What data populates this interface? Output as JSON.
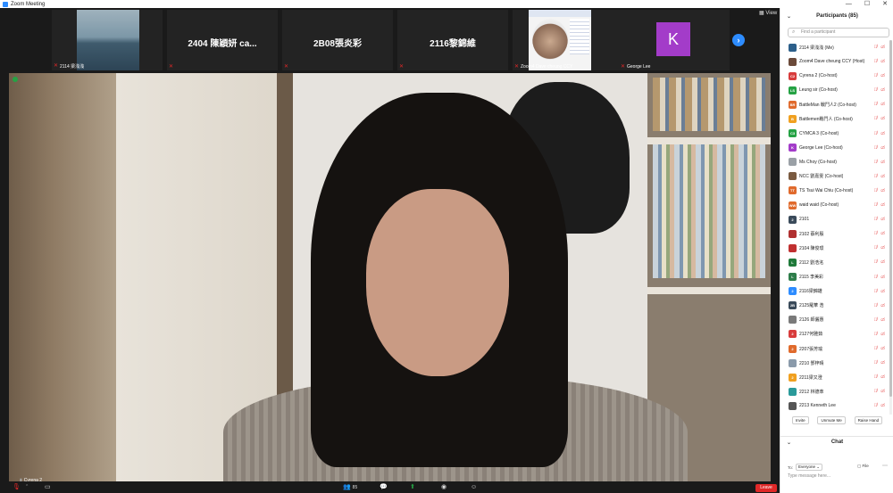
{
  "window": {
    "title": "Zoom Meeting",
    "controls": [
      "—",
      "☐",
      "✕"
    ]
  },
  "gallery": {
    "tiles": [
      {
        "label": "2114 梁浅浅",
        "name": "",
        "kind": "video-sea"
      },
      {
        "label": "",
        "name": "2404 陳穎妍 ca...",
        "kind": "name"
      },
      {
        "label": "",
        "name": "2B08張炎彩",
        "kind": "name"
      },
      {
        "label": "",
        "name": "2116黎錦維",
        "kind": "name"
      },
      {
        "label": "Zoom4 Dave cheung CCY",
        "name": "",
        "kind": "video-einstein"
      },
      {
        "label": "George Lee",
        "name": "K",
        "kind": "avatar"
      }
    ],
    "next_label": "›",
    "view_label": "View"
  },
  "speaker": {
    "name": "Cyrena 2"
  },
  "toolbar": {
    "participants_count": "85",
    "leave_label": "Leave",
    "icons": [
      "mic-icon",
      "video-icon",
      "participants-icon",
      "chat-icon",
      "share-icon",
      "record-icon",
      "reactions-icon"
    ]
  },
  "panel": {
    "title": "Participants (85)",
    "search_placeholder": "Find a participant",
    "participants": [
      {
        "initials": "",
        "color": "#2c5f8a",
        "name": "2114 梁浅浅 (Me)"
      },
      {
        "initials": "",
        "color": "#6b4a3a",
        "name": "Zoom4 Dave cheung CCY (Host)"
      },
      {
        "initials": "C2",
        "color": "#d83c3c",
        "name": "Cyrena 2 (Co-host)"
      },
      {
        "initials": "LS",
        "color": "#25a244",
        "name": "Leung sir (Co-host)"
      },
      {
        "initials": "BR",
        "color": "#e06a2c",
        "name": "BattleMan 戰鬥人2 (Co-host)"
      },
      {
        "initials": "B",
        "color": "#f0a020",
        "name": "Battlemen戰鬥人 (Co-host)"
      },
      {
        "initials": "C3",
        "color": "#25a244",
        "name": "CYMCA 3 (Co-host)"
      },
      {
        "initials": "K",
        "color": "#a33cc9",
        "name": "George Lee (Co-host)"
      },
      {
        "initials": "",
        "color": "#9aa0a6",
        "name": "Ms Choy (Co-host)"
      },
      {
        "initials": "",
        "color": "#7a5a40",
        "name": "NCC 劉嘉雯 (Co-host)"
      },
      {
        "initials": "TT",
        "color": "#e06a2c",
        "name": "TS Tsui Wai Chiu (Co-host)"
      },
      {
        "initials": "WW",
        "color": "#e06a2c",
        "name": "waid waid (Co-host)"
      },
      {
        "initials": "2",
        "color": "#3a4a5a",
        "name": "2101"
      },
      {
        "initials": "",
        "color": "#b03030",
        "name": "2102 蔡利殷"
      },
      {
        "initials": "",
        "color": "#c03030",
        "name": "2104 陳俊璟"
      },
      {
        "initials": "L",
        "color": "#1f7a3a",
        "name": "2112 劉浩洺"
      },
      {
        "initials": "L",
        "color": "#2e7d4a",
        "name": "2115 李美彩"
      },
      {
        "initials": "2",
        "color": "#2d8cff",
        "name": "2116梁錦雄"
      },
      {
        "initials": "2B",
        "color": "#3a4a5a",
        "name": "2125羅華 浩"
      },
      {
        "initials": "",
        "color": "#7a7a7a",
        "name": "2126 師儷惠"
      },
      {
        "initials": "2",
        "color": "#d83c3c",
        "name": "2127何雅茹"
      },
      {
        "initials": "2",
        "color": "#e06a2c",
        "name": "2207張芳瑜"
      },
      {
        "initials": "",
        "color": "#8a9aaa",
        "name": "2210 鄧梓晴"
      },
      {
        "initials": "2",
        "color": "#f0a020",
        "name": "2211梁又澄"
      },
      {
        "initials": "",
        "color": "#2a9a9a",
        "name": "2212 林德萃"
      },
      {
        "initials": "",
        "color": "#555555",
        "name": "2213 Kenneth Lee"
      }
    ],
    "buttons": {
      "invite": "Invite",
      "unmute": "Unmute Me",
      "raise": "Raise Hand"
    }
  },
  "chat": {
    "title": "Chat",
    "to_label": "To:",
    "to_value": "Everyone",
    "file_label": "File",
    "placeholder": "Type message here..."
  }
}
